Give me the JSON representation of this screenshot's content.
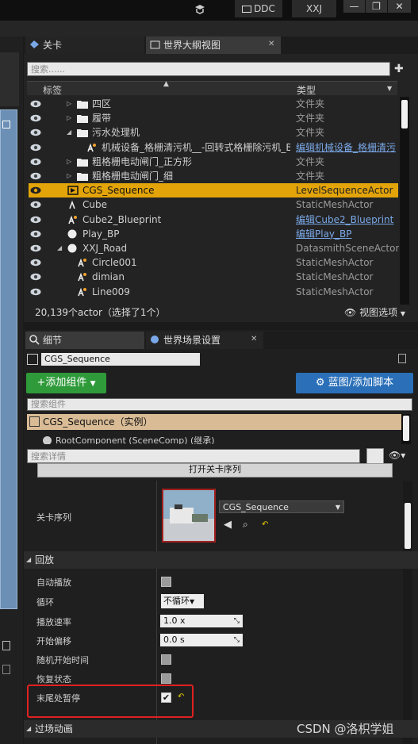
{
  "topbar": {
    "ddc_label": "DDC",
    "user_label": "XXJ",
    "minimize": "—",
    "restore": "❐",
    "close": "✕"
  },
  "outliner": {
    "tabs": [
      {
        "label": "关卡"
      },
      {
        "label": "世界大纲视图"
      }
    ],
    "search_placeholder": "搜索......",
    "col_label": "标签",
    "col_type": "类型",
    "rows": [
      {
        "name": "四区",
        "type": "文件夹"
      },
      {
        "name": "履带",
        "type": "文件夹"
      },
      {
        "name": "污水处理机",
        "type": "文件夹"
      },
      {
        "name": "机械设备_格栅清污机__-回转式格栅除污机_BP",
        "type": "编辑机械设备_格栅清污"
      },
      {
        "name": "粗格栅电动闸门_正方形",
        "type": "文件夹"
      },
      {
        "name": "粗格栅电动闸门_细",
        "type": "文件夹"
      },
      {
        "name": "CGS_Sequence",
        "type": "LevelSequenceActor"
      },
      {
        "name": "Cube",
        "type": "StaticMeshActor"
      },
      {
        "name": "Cube2_Blueprint",
        "type": "编辑Cube2_Blueprint"
      },
      {
        "name": "Play_BP",
        "type": "编辑Play_BP"
      },
      {
        "name": "XXJ_Road",
        "type": "DatasmithSceneActor"
      },
      {
        "name": "Circle001",
        "type": "StaticMeshActor"
      },
      {
        "name": "dimian",
        "type": "StaticMeshActor"
      },
      {
        "name": "Line009",
        "type": "StaticMeshActor"
      }
    ],
    "status": "20,139个actor（选择了1个）",
    "view_options": "视图选项"
  },
  "details": {
    "tabs": [
      {
        "label": "细节"
      },
      {
        "label": "世界场景设置"
      }
    ],
    "actor_name": "CGS_Sequence",
    "add_component": "+添加组件",
    "blueprint_button": "蓝图/添加脚本",
    "search_components": "搜索组件",
    "instance_label": "CGS_Sequence（实例）",
    "root_component": "RootComponent (SceneComp) (继承)",
    "search_details": "搜索详情",
    "open_sequence": "打开关卡序列",
    "level_sequence_label": "关卡序列",
    "sequence_asset": "CGS_Sequence",
    "playback_section": "回放",
    "props": {
      "autoplay": "自动播放",
      "loop": "循环",
      "loop_value": "不循环",
      "play_rate": "播放速率",
      "play_rate_value": "1.0 x",
      "start_offset": "开始偏移",
      "start_offset_value": "0.0 s",
      "random_start": "随机开始时间",
      "restore_state": "恢复状态",
      "pause_at_end": "末尾处暂停"
    },
    "transition_section": "过场动画"
  },
  "watermark": "CSDN @洛枳学姐",
  "colors": {
    "selection": "#e3a40a",
    "add_button": "#2f9a3a",
    "blueprint_button": "#2a6fb8",
    "highlight_box": "#e02020"
  }
}
